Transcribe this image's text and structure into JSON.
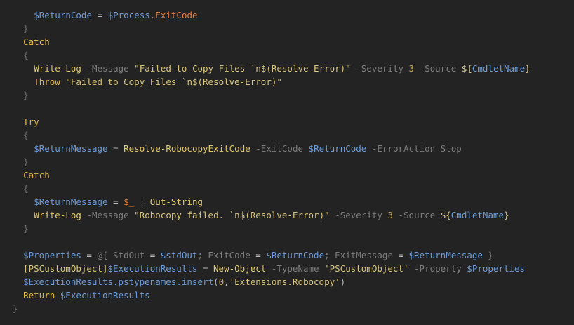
{
  "editor": {
    "language": "PowerShell",
    "lines": [
      {
        "indent": 4,
        "tokens": [
          {
            "k": "var",
            "t": "$ReturnCode"
          },
          {
            "k": "op",
            "t": " = "
          },
          {
            "k": "var",
            "t": "$Process"
          },
          {
            "k": "dollar",
            "t": ".ExitCode"
          }
        ]
      },
      {
        "indent": 2,
        "tokens": [
          {
            "k": "brace",
            "t": "}"
          }
        ]
      },
      {
        "indent": 2,
        "tokens": [
          {
            "k": "kw",
            "t": "Catch"
          }
        ]
      },
      {
        "indent": 2,
        "tokens": [
          {
            "k": "brace",
            "t": "{"
          }
        ]
      },
      {
        "indent": 4,
        "tokens": [
          {
            "k": "cmd",
            "t": "Write-Log"
          },
          {
            "k": "param",
            "t": " -Message"
          },
          {
            "k": "str",
            "t": " \"Failed to Copy Files `n$(Resolve-Error)\""
          },
          {
            "k": "param",
            "t": " -Severity"
          },
          {
            "k": "num",
            "t": " 3"
          },
          {
            "k": "param",
            "t": " -Source"
          },
          {
            "k": "str",
            "t": " ${"
          },
          {
            "k": "var",
            "t": "CmdletName"
          },
          {
            "k": "str",
            "t": "}"
          }
        ]
      },
      {
        "indent": 4,
        "tokens": [
          {
            "k": "kw",
            "t": "Throw"
          },
          {
            "k": "str",
            "t": " \"Failed to Copy Files `n$(Resolve-Error)\""
          }
        ]
      },
      {
        "indent": 2,
        "tokens": [
          {
            "k": "brace",
            "t": "}"
          }
        ]
      },
      {
        "indent": 0,
        "tokens": []
      },
      {
        "indent": 2,
        "tokens": [
          {
            "k": "kw",
            "t": "Try"
          }
        ]
      },
      {
        "indent": 2,
        "tokens": [
          {
            "k": "brace",
            "t": "{"
          }
        ]
      },
      {
        "indent": 4,
        "tokens": [
          {
            "k": "var",
            "t": "$ReturnMessage"
          },
          {
            "k": "op",
            "t": " = "
          },
          {
            "k": "cmd",
            "t": "Resolve-RobocopyExitCode"
          },
          {
            "k": "param",
            "t": " -ExitCode"
          },
          {
            "k": "var",
            "t": " $ReturnCode"
          },
          {
            "k": "param",
            "t": " -ErrorAction Stop"
          }
        ]
      },
      {
        "indent": 2,
        "tokens": [
          {
            "k": "brace",
            "t": "}"
          }
        ]
      },
      {
        "indent": 2,
        "tokens": [
          {
            "k": "kw",
            "t": "Catch"
          }
        ]
      },
      {
        "indent": 2,
        "tokens": [
          {
            "k": "brace",
            "t": "{"
          }
        ]
      },
      {
        "indent": 4,
        "tokens": [
          {
            "k": "var",
            "t": "$ReturnMessage"
          },
          {
            "k": "op",
            "t": " = "
          },
          {
            "k": "dollar",
            "t": "$_"
          },
          {
            "k": "op",
            "t": " | "
          },
          {
            "k": "cmd",
            "t": "Out-String"
          }
        ]
      },
      {
        "indent": 4,
        "tokens": [
          {
            "k": "cmd",
            "t": "Write-Log"
          },
          {
            "k": "param",
            "t": " -Message"
          },
          {
            "k": "str",
            "t": " \"Robocopy failed. `n$(Resolve-Error)\""
          },
          {
            "k": "param",
            "t": " -Severity"
          },
          {
            "k": "num",
            "t": " 3"
          },
          {
            "k": "param",
            "t": " -Source"
          },
          {
            "k": "str",
            "t": " ${"
          },
          {
            "k": "var",
            "t": "CmdletName"
          },
          {
            "k": "str",
            "t": "}"
          }
        ]
      },
      {
        "indent": 2,
        "tokens": [
          {
            "k": "brace",
            "t": "}"
          }
        ]
      },
      {
        "indent": 0,
        "tokens": []
      },
      {
        "indent": 2,
        "tokens": [
          {
            "k": "var",
            "t": "$Properties"
          },
          {
            "k": "op",
            "t": " = "
          },
          {
            "k": "param",
            "t": "@{ StdOut"
          },
          {
            "k": "op",
            "t": " = "
          },
          {
            "k": "var",
            "t": "$stdOut"
          },
          {
            "k": "param",
            "t": "; ExitCode"
          },
          {
            "k": "op",
            "t": " = "
          },
          {
            "k": "var",
            "t": "$ReturnCode"
          },
          {
            "k": "param",
            "t": "; ExitMessage"
          },
          {
            "k": "op",
            "t": " = "
          },
          {
            "k": "var",
            "t": "$ReturnMessage"
          },
          {
            "k": "param",
            "t": " }"
          }
        ]
      },
      {
        "indent": 2,
        "tokens": [
          {
            "k": "type",
            "t": "[PSCustomObject]"
          },
          {
            "k": "var",
            "t": "$ExecutionResults"
          },
          {
            "k": "op",
            "t": " = "
          },
          {
            "k": "cmd",
            "t": "New-Object"
          },
          {
            "k": "param",
            "t": " -TypeName"
          },
          {
            "k": "str",
            "t": " 'PSCustomObject'"
          },
          {
            "k": "param",
            "t": " -Property"
          },
          {
            "k": "var",
            "t": " $Properties"
          }
        ]
      },
      {
        "indent": 2,
        "tokens": [
          {
            "k": "var",
            "t": "$ExecutionResults.pstypenames.insert"
          },
          {
            "k": "op",
            "t": "("
          },
          {
            "k": "num",
            "t": "0"
          },
          {
            "k": "op",
            "t": ","
          },
          {
            "k": "str",
            "t": "'Extensions.Robocopy'"
          },
          {
            "k": "op",
            "t": ")"
          }
        ]
      },
      {
        "indent": 2,
        "tokens": [
          {
            "k": "kw",
            "t": "Return"
          },
          {
            "k": "var",
            "t": " $ExecutionResults"
          }
        ]
      },
      {
        "indent": 0,
        "tokens": [
          {
            "k": "brace",
            "t": "}"
          }
        ]
      }
    ]
  },
  "colors": {
    "background": "#232323"
  }
}
